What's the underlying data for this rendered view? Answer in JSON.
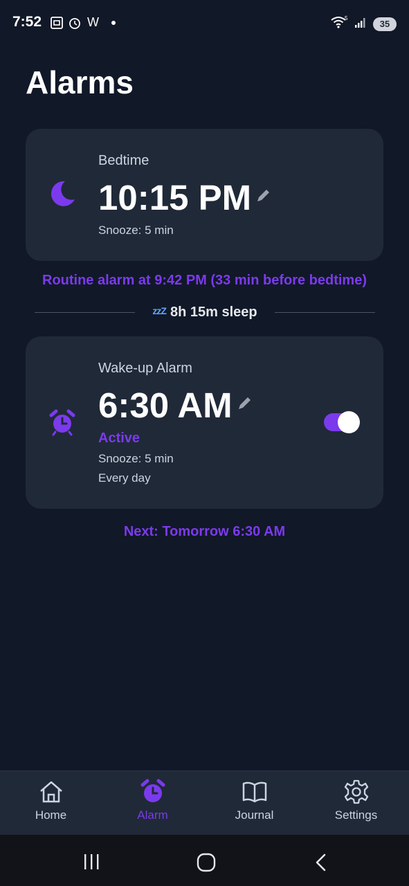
{
  "status_bar": {
    "time": "7:52",
    "left_icons": [
      "screenshot-icon",
      "alarm-clock-icon"
    ],
    "w_label": "W",
    "battery": "35"
  },
  "page": {
    "title": "Alarms"
  },
  "bedtime": {
    "label": "Bedtime",
    "time": "10:15 PM",
    "snooze": "Snooze: 5 min",
    "icon": "moon-icon"
  },
  "routine_text": "Routine alarm at 9:42 PM (33 min before bedtime)",
  "sleep_duration": "8h 15m sleep",
  "sleep_icon_text": "zzZ",
  "wake": {
    "label": "Wake-up Alarm",
    "time": "6:30 AM",
    "status": "Active",
    "snooze": "Snooze: 5 min",
    "repeat": "Every day",
    "enabled": true,
    "icon": "alarm-clock-icon"
  },
  "next_text": "Next: Tomorrow 6:30 AM",
  "nav": {
    "items": [
      {
        "label": "Home",
        "icon": "home-icon",
        "active": false
      },
      {
        "label": "Alarm",
        "icon": "alarm-clock-icon",
        "active": true
      },
      {
        "label": "Journal",
        "icon": "book-icon",
        "active": false
      },
      {
        "label": "Settings",
        "icon": "gear-icon",
        "active": false
      }
    ]
  },
  "colors": {
    "background": "#111827",
    "card": "#1f2937",
    "accent": "#7c3aed"
  }
}
